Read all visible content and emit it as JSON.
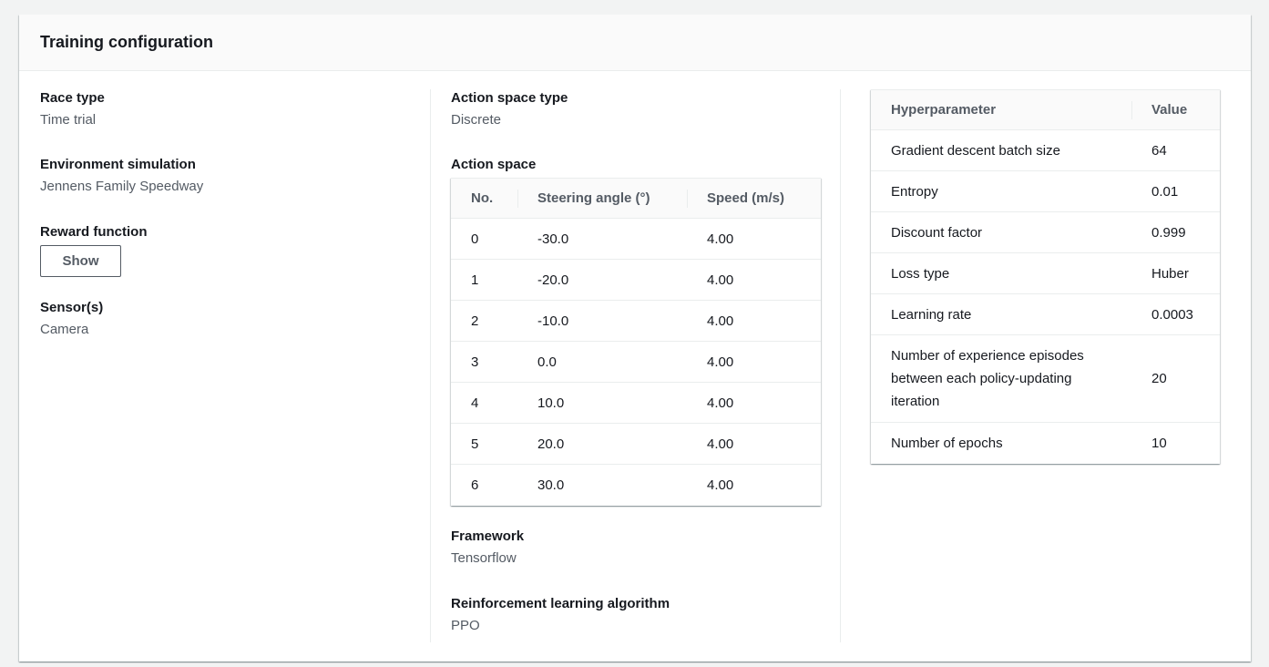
{
  "title": "Training configuration",
  "race_type": {
    "label": "Race type",
    "value": "Time trial"
  },
  "environment": {
    "label": "Environment simulation",
    "value": "Jennens Family Speedway"
  },
  "reward": {
    "label": "Reward function",
    "button": "Show"
  },
  "sensors": {
    "label": "Sensor(s)",
    "value": "Camera"
  },
  "action_space_type": {
    "label": "Action space type",
    "value": "Discrete"
  },
  "action_space": {
    "label": "Action space",
    "headers": [
      "No.",
      "Steering angle (°)",
      "Speed (m/s)"
    ],
    "rows": [
      [
        "0",
        "-30.0",
        "4.00"
      ],
      [
        "1",
        "-20.0",
        "4.00"
      ],
      [
        "2",
        "-10.0",
        "4.00"
      ],
      [
        "3",
        "0.0",
        "4.00"
      ],
      [
        "4",
        "10.0",
        "4.00"
      ],
      [
        "5",
        "20.0",
        "4.00"
      ],
      [
        "6",
        "30.0",
        "4.00"
      ]
    ]
  },
  "framework": {
    "label": "Framework",
    "value": "Tensorflow"
  },
  "algorithm": {
    "label": "Reinforcement learning algorithm",
    "value": "PPO"
  },
  "hyperparameters": {
    "headers": [
      "Hyperparameter",
      "Value"
    ],
    "rows": [
      [
        "Gradient descent batch size",
        "64"
      ],
      [
        "Entropy",
        "0.01"
      ],
      [
        "Discount factor",
        "0.999"
      ],
      [
        "Loss type",
        "Huber"
      ],
      [
        "Learning rate",
        "0.0003"
      ],
      [
        "Number of experience episodes between each policy-updating iteration",
        "20"
      ],
      [
        "Number of epochs",
        "10"
      ]
    ]
  }
}
